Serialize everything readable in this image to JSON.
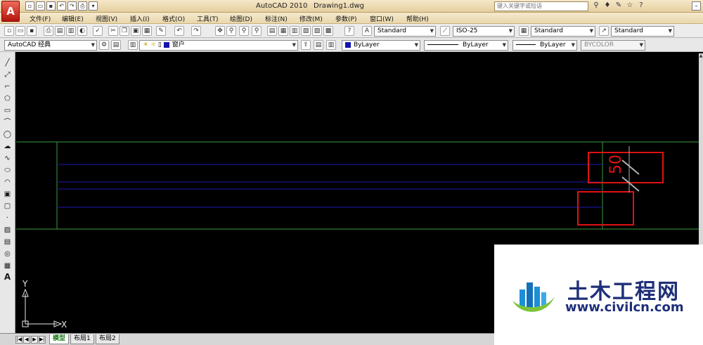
{
  "app": {
    "logo_letter": "A",
    "title": "AutoCAD 2010",
    "document": "Drawing1.dwg",
    "search_placeholder": "键入关键字或短语"
  },
  "quick_access": [
    "new-file",
    "open-file",
    "save",
    "undo",
    "redo",
    "print"
  ],
  "menu": [
    "文件(F)",
    "编辑(E)",
    "视图(V)",
    "插入(I)",
    "格式(O)",
    "工具(T)",
    "绘图(D)",
    "标注(N)",
    "修改(M)",
    "参数(P)",
    "窗口(W)",
    "帮助(H)"
  ],
  "styles": {
    "text_style": "Standard",
    "dim_style": "ISO-25",
    "table_style": "Standard",
    "multileader_style": "Standard"
  },
  "workspace": "AutoCAD 经典",
  "layer": "窗户",
  "properties": {
    "color": "ByLayer",
    "linetype": "ByLayer",
    "lineweight": "ByLayer",
    "plotstyle": "BYCOLOR"
  },
  "drawing": {
    "dimension_text": "50",
    "ucs_x": "X",
    "ucs_y": "Y",
    "colors": {
      "green": "#3c9b3c",
      "blue": "#1a1ab4",
      "red": "#e01212",
      "gray": "#b0b0b0",
      "white": "#e8e8e8"
    }
  },
  "tabs": [
    "模型",
    "布局1",
    "布局2"
  ],
  "watermark": {
    "title": "土木工程网",
    "url": "www.civilcn.com"
  }
}
